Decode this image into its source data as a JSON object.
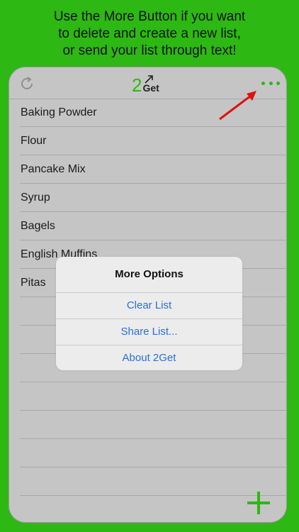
{
  "caption": {
    "line1": "Use the More Button if you want",
    "line2": "to delete and create a new list,",
    "line3": "or send your list through text!"
  },
  "app": {
    "logo_number": "2",
    "logo_text": "Get",
    "accent_color": "#2db814"
  },
  "items": [
    "Baking Powder",
    "Flour",
    "Pancake Mix",
    "Syrup",
    "Bagels",
    "English Muffins",
    "Pitas"
  ],
  "dialog": {
    "title": "More Options",
    "options": [
      "Clear List",
      "Share List...",
      "About 2Get"
    ],
    "link_color": "#2a6fd6"
  },
  "icons": {
    "refresh": "refresh-icon",
    "more": "more-dots-icon",
    "add": "plus-icon",
    "annotation": "red-arrow-icon"
  }
}
